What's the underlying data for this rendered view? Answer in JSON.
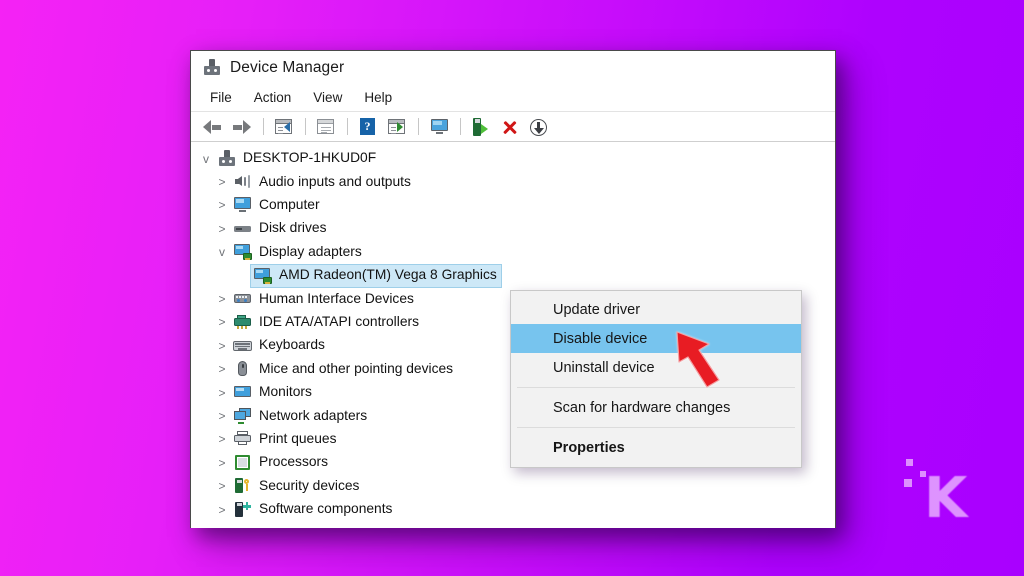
{
  "background": {
    "gradient_from": "#F522F5",
    "gradient_to": "#A900FF"
  },
  "watermark": {
    "letter": "K",
    "color": "#E6A8FF"
  },
  "window": {
    "title": "Device Manager",
    "title_icon": "device-manager-icon",
    "menu": [
      {
        "label": "File"
      },
      {
        "label": "Action"
      },
      {
        "label": "View"
      },
      {
        "label": "Help"
      }
    ],
    "toolbar": [
      {
        "name": "back-button",
        "icon": "arrow-left-icon"
      },
      {
        "name": "forward-button",
        "icon": "arrow-right-icon"
      },
      {
        "name": "show-hide-console-tree",
        "icon": "console-tree-icon"
      },
      {
        "name": "properties-button",
        "icon": "properties-icon"
      },
      {
        "name": "help-button",
        "icon": "help-icon"
      },
      {
        "name": "show-hide-action-pane",
        "icon": "action-pane-icon"
      },
      {
        "name": "update-driver-button",
        "icon": "monitor-update-icon"
      },
      {
        "name": "scan-hardware-changes",
        "icon": "scan-hardware-icon"
      },
      {
        "name": "uninstall-device-button",
        "icon": "red-x-icon"
      },
      {
        "name": "disable-device-button",
        "icon": "down-arrow-circle-icon"
      }
    ]
  },
  "tree": {
    "items": [
      {
        "label": "DESKTOP-1HKUD0F",
        "indent": 0,
        "chevron": "v",
        "icon": "computer-root-icon",
        "selected": false
      },
      {
        "label": "Audio inputs and outputs",
        "indent": 1,
        "chevron": ">",
        "icon": "audio-icon",
        "selected": false
      },
      {
        "label": "Computer",
        "indent": 1,
        "chevron": ">",
        "icon": "computer-icon",
        "selected": false
      },
      {
        "label": "Disk drives",
        "indent": 1,
        "chevron": ">",
        "icon": "disk-drive-icon",
        "selected": false
      },
      {
        "label": "Display adapters",
        "indent": 1,
        "chevron": "v",
        "icon": "display-adapter-icon",
        "selected": false
      },
      {
        "label": "AMD Radeon(TM) Vega 8 Graphics",
        "indent": 2,
        "chevron": "",
        "icon": "display-adapter-icon",
        "selected": true
      },
      {
        "label": "Human Interface Devices",
        "indent": 1,
        "chevron": ">",
        "icon": "hid-icon",
        "selected": false
      },
      {
        "label": "IDE ATA/ATAPI controllers",
        "indent": 1,
        "chevron": ">",
        "icon": "ide-controller-icon",
        "selected": false
      },
      {
        "label": "Keyboards",
        "indent": 1,
        "chevron": ">",
        "icon": "keyboard-icon",
        "selected": false
      },
      {
        "label": "Mice and other pointing devices",
        "indent": 1,
        "chevron": ">",
        "icon": "mouse-icon",
        "selected": false
      },
      {
        "label": "Monitors",
        "indent": 1,
        "chevron": ">",
        "icon": "monitor-icon",
        "selected": false
      },
      {
        "label": "Network adapters",
        "indent": 1,
        "chevron": ">",
        "icon": "network-adapter-icon",
        "selected": false
      },
      {
        "label": "Print queues",
        "indent": 1,
        "chevron": ">",
        "icon": "printer-icon",
        "selected": false
      },
      {
        "label": "Processors",
        "indent": 1,
        "chevron": ">",
        "icon": "processor-icon",
        "selected": false
      },
      {
        "label": "Security devices",
        "indent": 1,
        "chevron": ">",
        "icon": "security-device-icon",
        "selected": false
      },
      {
        "label": "Software components",
        "indent": 1,
        "chevron": ">",
        "icon": "software-component-icon",
        "selected": false
      }
    ]
  },
  "context_menu": {
    "highlight_color": "#77C4EE",
    "items": [
      {
        "label": "Update driver",
        "type": "item",
        "highlight": false,
        "bold": false
      },
      {
        "label": "Disable device",
        "type": "item",
        "highlight": true,
        "bold": false
      },
      {
        "label": "Uninstall device",
        "type": "item",
        "highlight": false,
        "bold": false
      },
      {
        "label": "",
        "type": "separator",
        "highlight": false,
        "bold": false
      },
      {
        "label": "Scan for hardware changes",
        "type": "item",
        "highlight": false,
        "bold": false
      },
      {
        "label": "",
        "type": "separator",
        "highlight": false,
        "bold": false
      },
      {
        "label": "Properties",
        "type": "item",
        "highlight": false,
        "bold": true
      }
    ]
  },
  "pointer": {
    "name": "red-arrow-pointer",
    "color": "#E81C23"
  }
}
